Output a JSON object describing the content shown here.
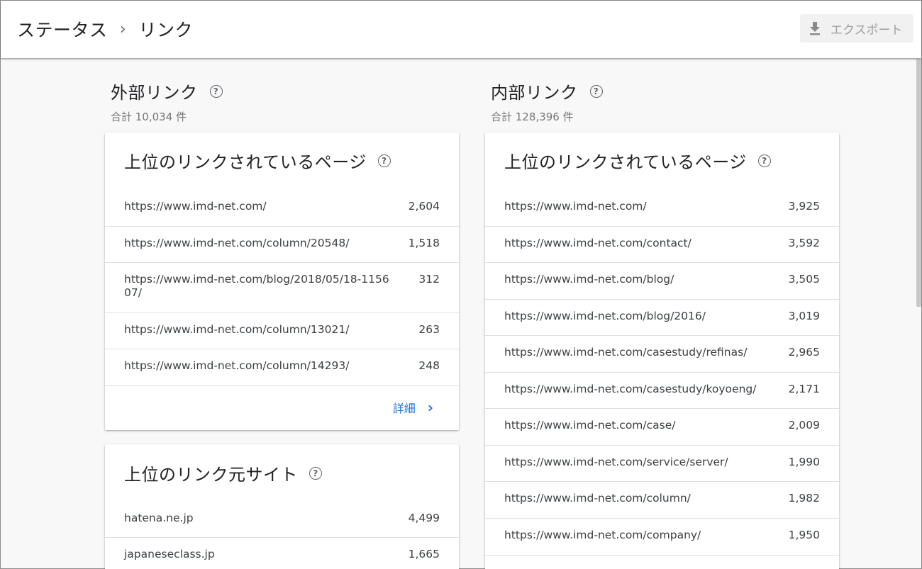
{
  "breadcrumb": {
    "parent": "ステータス",
    "separator": "›",
    "current": "リンク"
  },
  "toolbar": {
    "export_label": "エクスポート",
    "export_icon": "download-icon"
  },
  "external": {
    "title": "外部リンク",
    "total": "合計 10,034 件",
    "top_pages": {
      "title": "上位のリンクされているページ",
      "rows": [
        {
          "url": "https://www.imd-net.com/",
          "count": "2,604"
        },
        {
          "url": "https://www.imd-net.com/column/20548/",
          "count": "1,518"
        },
        {
          "url_line1": "https://www.imd-net.com/blog/2018/05/18-1156",
          "url_line2": "07/",
          "count": "312"
        },
        {
          "url": "https://www.imd-net.com/column/13021/",
          "count": "263"
        },
        {
          "url": "https://www.imd-net.com/column/14293/",
          "count": "248"
        }
      ],
      "detail_label": "詳細"
    },
    "top_sites": {
      "title": "上位のリンク元サイト",
      "rows": [
        {
          "url": "hatena.ne.jp",
          "count": "4,499"
        },
        {
          "url": "japaneseclass.jp",
          "count": "1,665"
        }
      ]
    }
  },
  "internal": {
    "title": "内部リンク",
    "total": "合計 128,396 件",
    "top_pages": {
      "title": "上位のリンクされているページ",
      "rows": [
        {
          "url": "https://www.imd-net.com/",
          "count": "3,925"
        },
        {
          "url": "https://www.imd-net.com/contact/",
          "count": "3,592"
        },
        {
          "url": "https://www.imd-net.com/blog/",
          "count": "3,505"
        },
        {
          "url": "https://www.imd-net.com/blog/2016/",
          "count": "3,019"
        },
        {
          "url": "https://www.imd-net.com/casestudy/refinas/",
          "count": "2,965"
        },
        {
          "url": "https://www.imd-net.com/casestudy/koyoeng/",
          "count": "2,171"
        },
        {
          "url": "https://www.imd-net.com/case/",
          "count": "2,009"
        },
        {
          "url": "https://www.imd-net.com/service/server/",
          "count": "1,990"
        },
        {
          "url": "https://www.imd-net.com/column/",
          "count": "1,982"
        },
        {
          "url": "https://www.imd-net.com/company/",
          "count": "1,950"
        }
      ]
    }
  },
  "colors": {
    "accent": "#1a73e8",
    "background": "#f8f8f8",
    "card": "#ffffff"
  }
}
